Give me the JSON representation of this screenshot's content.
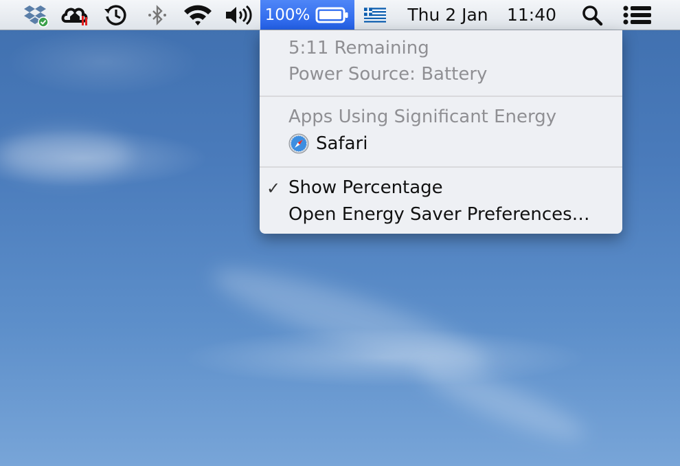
{
  "menubar": {
    "battery": {
      "percentage": "100%",
      "level": 1.0
    },
    "date": "Thu 2 Jan",
    "time": "11:40",
    "icons": [
      "dropbox-icon",
      "cloud-sync-icon",
      "time-machine-icon",
      "bluetooth-icon",
      "wifi-icon",
      "volume-icon",
      "battery-icon",
      "greek-flag-icon",
      "spotlight-search-icon",
      "notification-center-icon"
    ]
  },
  "battery_menu": {
    "remaining": "5:11 Remaining",
    "power_source": "Power Source: Battery",
    "apps_header": "Apps Using Significant Energy",
    "apps": [
      {
        "name": "Safari",
        "icon": "safari-icon"
      }
    ],
    "show_percentage": "Show Percentage",
    "show_percentage_checked": true,
    "check_mark": "✓",
    "open_preferences": "Open Energy Saver Preferences…"
  },
  "colors": {
    "highlight": "#2e6ff4",
    "disabled_text": "#8f8f93",
    "menu_background": "#f4f4f6"
  }
}
